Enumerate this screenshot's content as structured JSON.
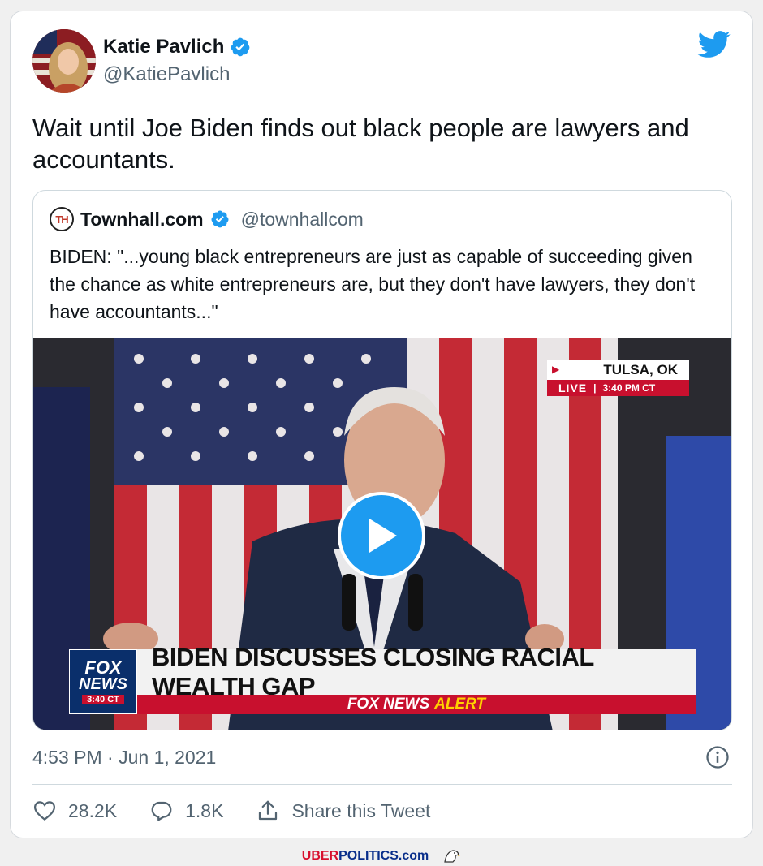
{
  "author": {
    "display_name": "Katie Pavlich",
    "handle": "@KatiePavlich",
    "verified_icon": "verified-badge-icon",
    "avatar": "avatar"
  },
  "brand_icon": "twitter-bird-icon",
  "tweet": {
    "text": "Wait until Joe Biden finds out black people are lawyers and accountants.",
    "timestamp": "4:53 PM · Jun 1, 2021"
  },
  "quoted_tweet": {
    "logo_text": "TH",
    "display_name": "Townhall.com",
    "handle": "@townhallcom",
    "text": "BIDEN: \"...young black entrepreneurs are just as capable of succeeding given the chance as white entrepreneurs are, but they don't have lawyers, they don't have accountants...\""
  },
  "video": {
    "location": "TULSA, OK",
    "live_label": "LIVE",
    "live_time": "3:40 PM CT",
    "network_line1": "FOX",
    "network_line2": "NEWS",
    "network_time": "3:40 CT",
    "headline": "BIDEN DISCUSSES CLOSING RACIAL WEALTH GAP",
    "alert_network": "FOX NEWS",
    "alert_word": "ALERT"
  },
  "actions": {
    "likes": "28.2K",
    "replies": "1.8K",
    "share_label": "Share this Tweet"
  },
  "footer": {
    "brand_part1": "UBER",
    "brand_part2": "POLITICS.com"
  },
  "colors": {
    "twitter_blue": "#1d9bf0",
    "fox_red": "#c8102e",
    "fox_navy": "#0a2f6b"
  }
}
